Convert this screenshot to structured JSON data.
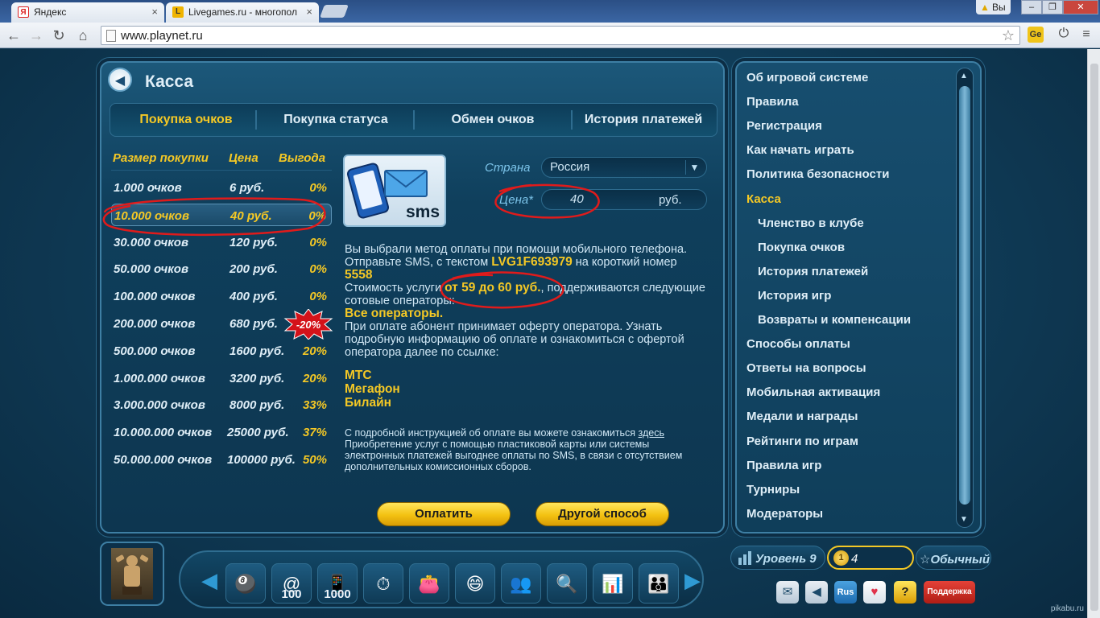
{
  "browser": {
    "tabs": [
      {
        "label": "Яндекс",
        "favicon": "Я"
      },
      {
        "label": "Livegames.ru - многопол",
        "favicon": "L"
      }
    ],
    "user_badge": "Вы",
    "url": "www.playnet.ru",
    "ext_ge": "Ge"
  },
  "panel": {
    "title": "Касса",
    "tabs": [
      "Покупка очков",
      "Покупка статуса",
      "Обмен очков",
      "История платежей"
    ],
    "table": {
      "headers": [
        "Размер покупки",
        "Цена",
        "Выгода"
      ],
      "rows": [
        {
          "points": "1.000 очков",
          "price": "6 руб.",
          "benefit": "0%"
        },
        {
          "points": "10.000 очков",
          "price": "40 руб.",
          "benefit": "0%"
        },
        {
          "points": "30.000 очков",
          "price": "120 руб.",
          "benefit": "0%"
        },
        {
          "points": "50.000 очков",
          "price": "200 руб.",
          "benefit": "0%"
        },
        {
          "points": "100.000 очков",
          "price": "400 руб.",
          "benefit": "0%"
        },
        {
          "points": "200.000 очков",
          "price": "680 руб.",
          "benefit": ""
        },
        {
          "points": "500.000 очков",
          "price": "1600 руб.",
          "benefit": "20%"
        },
        {
          "points": "1.000.000 очков",
          "price": "3200 руб.",
          "benefit": "20%"
        },
        {
          "points": "3.000.000 очков",
          "price": "8000 руб.",
          "benefit": "33%"
        },
        {
          "points": "10.000.000 очков",
          "price": "25000 руб.",
          "benefit": "37%"
        },
        {
          "points": "50.000.000 очков",
          "price": "100000 руб.",
          "benefit": "50%"
        }
      ],
      "promo_badge": "-20%"
    },
    "sms_label": "sms",
    "country_label": "Страна",
    "country_value": "Россия",
    "price_label": "Цена*",
    "price_value": "40",
    "price_unit": "руб.",
    "info": {
      "line1": "Вы выбрали метод оплаты при помощи мобильного телефона. Отправьте SMS, с текстом ",
      "code": "LVG1F693979",
      "line2": " на короткий номер ",
      "number": "5558",
      "cost_prefix": "Стоимость услуги ",
      "cost_range": "от 59 до 60 руб.",
      "cost_suffix": ", поддерживаются следующие сотовые операторы:",
      "all_ops": "Все операторы.",
      "offer": "При оплате абонент принимает оферту оператора. Узнать подробную информацию об оплате и ознакомиться с офертой оператора далее по ссылке:"
    },
    "operators": [
      "МТС",
      "Мегафон",
      "Билайн"
    ],
    "note": {
      "prefix": "С подробной инструкцией об оплате вы можете ознакомиться ",
      "link": "здесь",
      "rest": "Приобретение услуг с помощью пластиковой карты или системы электронных платежей выгоднее оплаты по SMS, в связи с отсутствием дополнительных комиссионных сборов."
    },
    "pay_button": "Оплатить",
    "other_button": "Другой способ"
  },
  "sidebar": {
    "items": [
      {
        "label": "Об игровой системе",
        "sub": false,
        "active": false
      },
      {
        "label": "Правила",
        "sub": false,
        "active": false
      },
      {
        "label": "Регистрация",
        "sub": false,
        "active": false
      },
      {
        "label": "Как начать играть",
        "sub": false,
        "active": false
      },
      {
        "label": "Политика безопасности",
        "sub": false,
        "active": false
      },
      {
        "label": "Касса",
        "sub": false,
        "active": true
      },
      {
        "label": "Членство в клубе",
        "sub": true,
        "active": false
      },
      {
        "label": "Покупка очков",
        "sub": true,
        "active": false
      },
      {
        "label": "История платежей",
        "sub": true,
        "active": false
      },
      {
        "label": "История игр",
        "sub": true,
        "active": false
      },
      {
        "label": "Возвраты и компенсации",
        "sub": true,
        "active": false
      },
      {
        "label": "Способы оплаты",
        "sub": false,
        "active": false
      },
      {
        "label": "Ответы на вопросы",
        "sub": false,
        "active": false
      },
      {
        "label": "Мобильная активация",
        "sub": false,
        "active": false
      },
      {
        "label": "Медали и награды",
        "sub": false,
        "active": false
      },
      {
        "label": "Рейтинги по играм",
        "sub": false,
        "active": false
      },
      {
        "label": "Правила игр",
        "sub": false,
        "active": false
      },
      {
        "label": "Турниры",
        "sub": false,
        "active": false
      },
      {
        "label": "Модераторы",
        "sub": false,
        "active": false
      }
    ]
  },
  "toolbar": {
    "icons": [
      {
        "name": "games-icon",
        "glyph": "🎱",
        "label": ""
      },
      {
        "name": "mail-100-icon",
        "glyph": "@",
        "label": "100"
      },
      {
        "name": "phone-1000-icon",
        "glyph": "📱",
        "label": "1000"
      },
      {
        "name": "coin-timer-icon",
        "glyph": "⏱",
        "label": ""
      },
      {
        "name": "wallet-icon",
        "glyph": "👛",
        "label": ""
      },
      {
        "name": "faces-icon",
        "glyph": "😄",
        "label": ""
      },
      {
        "name": "friends-icon",
        "glyph": "👥",
        "label": ""
      },
      {
        "name": "search-user-icon",
        "glyph": "🔍",
        "label": ""
      },
      {
        "name": "ratings-chart-icon",
        "glyph": "📊",
        "label": ""
      },
      {
        "name": "add-friend-icon",
        "glyph": "👪",
        "label": ""
      }
    ]
  },
  "status": {
    "level": "Уровень 9",
    "coins": "4",
    "coin_glyph": "1",
    "account_type": "Обычный",
    "star": "☆",
    "lang": "Rus",
    "help": "?",
    "support": "Поддержка"
  },
  "watermark": "pikabu.ru"
}
